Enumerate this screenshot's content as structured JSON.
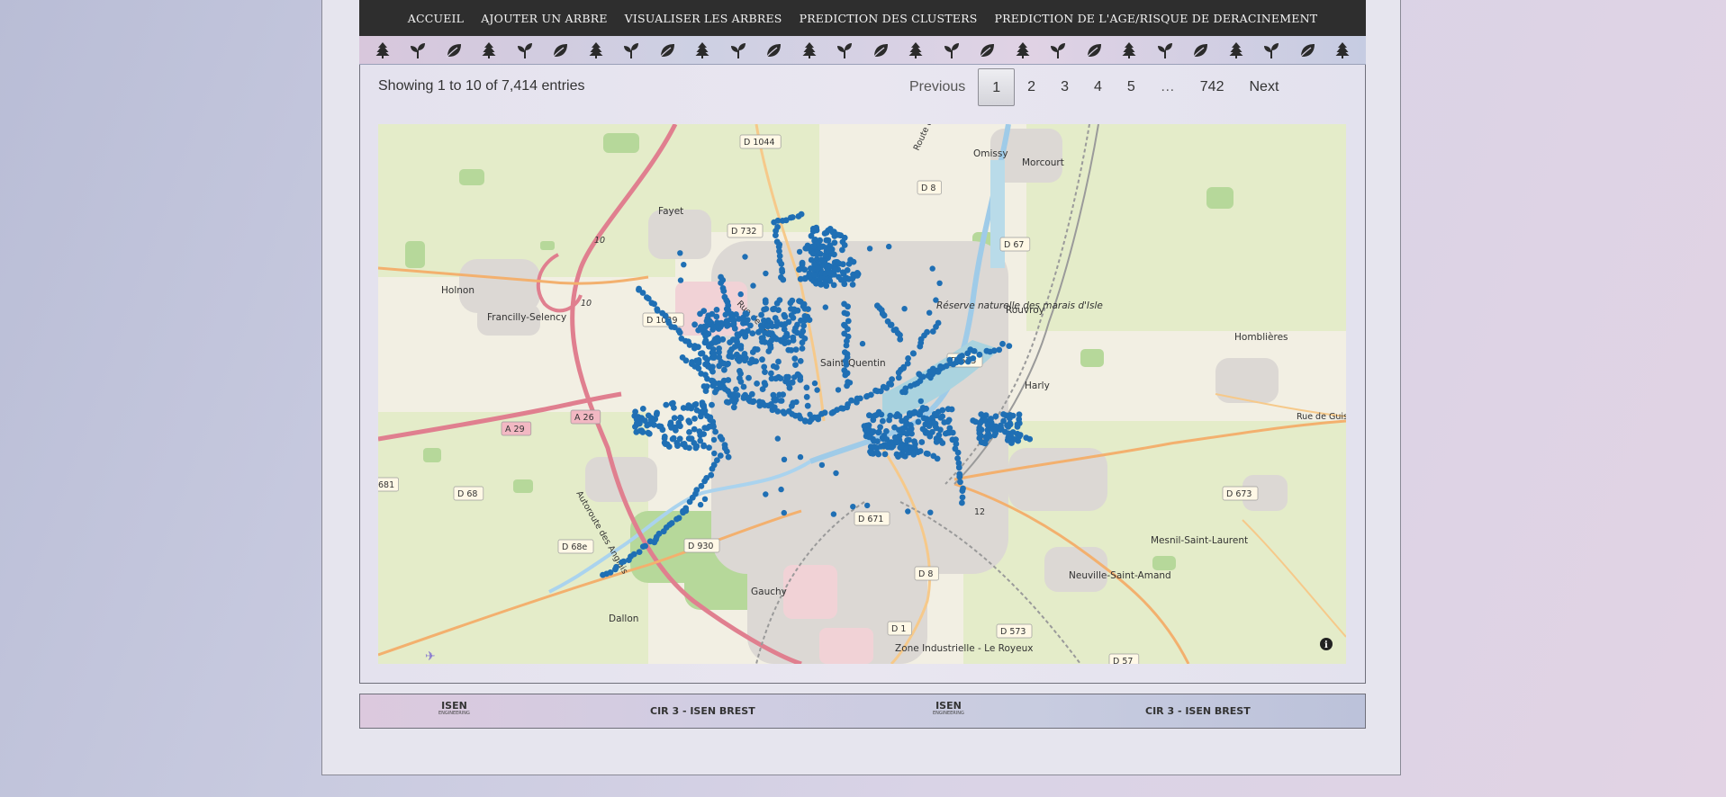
{
  "navbar": {
    "links": [
      "ACCUEIL",
      "AJOUTER UN ARBRE",
      "VISUALISER LES ARBRES",
      "PREDICTION DES CLUSTERS",
      "PREDICTION DE L'AGE/RISQUE DE DERACINEMENT"
    ]
  },
  "icon_strip": {
    "pattern": [
      "tree-icon",
      "sprout-icon",
      "leaf-icon"
    ],
    "count": 28,
    "color": "#2b2b2b"
  },
  "table_info": {
    "entries_text": "Showing 1 to 10 of 7,414 entries"
  },
  "pagination": {
    "previous": "Previous",
    "pages": [
      "1",
      "2",
      "3",
      "4",
      "5",
      "…",
      "742"
    ],
    "active_page": "1",
    "next": "Next"
  },
  "map": {
    "places": [
      "Omissy",
      "Morcourt",
      "Fayet",
      "Holnon",
      "Francilly-Selency",
      "Rouvroy",
      "Saint-Quentin",
      "Harly",
      "Homblières",
      "Gauchy",
      "Dallon",
      "Mesnil-Saint-Laurent",
      "Neuville-Saint-Amand",
      "Zone Industrielle - Le Royeux",
      "Réserve naturelle des marais d'Isle"
    ],
    "roads": [
      "D 1044",
      "D 8",
      "D 732",
      "D 67",
      "D 1029",
      "D 675",
      "A 29",
      "A 26",
      "D 68",
      "681",
      "D 673",
      "D 671",
      "D 68e",
      "D 8",
      "D 1",
      "D 573",
      "D 57",
      "D 930",
      "Rue de Guise",
      "Autoroute des Anglais",
      "Route de Lesdins",
      "Rue de Paris",
      "10",
      "10",
      "12"
    ],
    "marker_color": "#1f6fb4",
    "info_icon": "info-icon"
  },
  "footer": {
    "logo_text": "ISEN",
    "logo_sub": "ENGINEERING",
    "label": "CIR 3 - ISEN BREST"
  }
}
